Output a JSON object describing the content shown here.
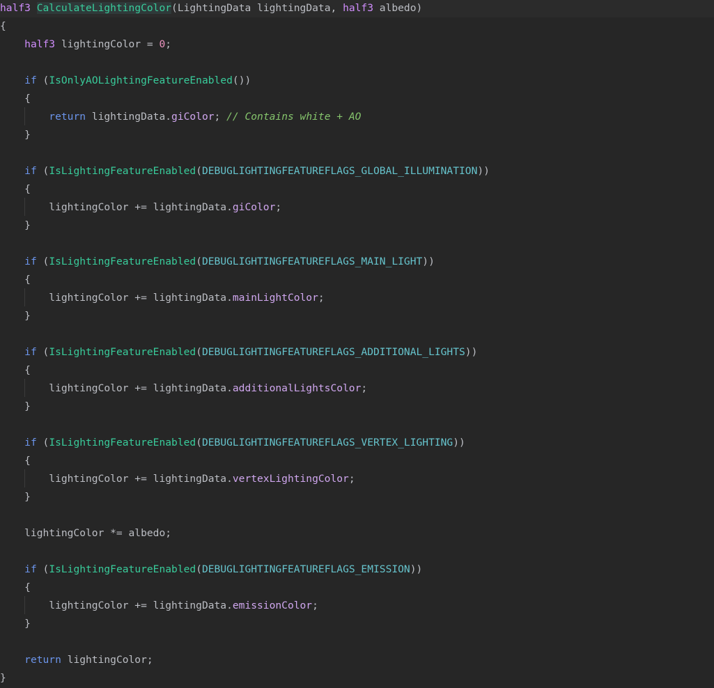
{
  "editor": {
    "language": "HLSL",
    "colors": {
      "background": "#262626",
      "keyword_type": "#cf8dfb",
      "keyword_control": "#6c95eb",
      "function": "#39cc9b",
      "constant": "#66c3cc",
      "field": "#d0a7ef",
      "comment": "#85c46c",
      "number": "#ed94c0",
      "text": "#bcbec4"
    },
    "lines": [
      [
        [
          "kw",
          "half3"
        ],
        [
          "plain",
          " "
        ],
        [
          "fn-decl",
          "CalculateLightingColor"
        ],
        [
          "plain",
          "("
        ],
        [
          "plain",
          "LightingData"
        ],
        [
          "plain",
          " lightingData, "
        ],
        [
          "kw",
          "half3"
        ],
        [
          "plain",
          " albedo)"
        ]
      ],
      [
        [
          "plain",
          "{"
        ]
      ],
      [
        [
          "plain",
          "    "
        ],
        [
          "kw",
          "half3"
        ],
        [
          "plain",
          " lightingColor = "
        ],
        [
          "num",
          "0"
        ],
        [
          "plain",
          ";"
        ]
      ],
      [],
      [
        [
          "plain",
          "    "
        ],
        [
          "kwb",
          "if"
        ],
        [
          "plain",
          " ("
        ],
        [
          "fn",
          "IsOnlyAOLightingFeatureEnabled"
        ],
        [
          "plain",
          "())"
        ]
      ],
      [
        [
          "plain",
          "    {"
        ]
      ],
      [
        [
          "plain",
          "        "
        ],
        [
          "kwb",
          "return"
        ],
        [
          "plain",
          " lightingData."
        ],
        [
          "field",
          "giColor"
        ],
        [
          "plain",
          "; "
        ],
        [
          "comment",
          "// Contains white + AO"
        ]
      ],
      [
        [
          "plain",
          "    }"
        ]
      ],
      [],
      [
        [
          "plain",
          "    "
        ],
        [
          "kwb",
          "if"
        ],
        [
          "plain",
          " ("
        ],
        [
          "fn",
          "IsLightingFeatureEnabled"
        ],
        [
          "plain",
          "("
        ],
        [
          "const",
          "DEBUGLIGHTINGFEATUREFLAGS_GLOBAL_ILLUMINATION"
        ],
        [
          "plain",
          "))"
        ]
      ],
      [
        [
          "plain",
          "    {"
        ]
      ],
      [
        [
          "plain",
          "        lightingColor += lightingData."
        ],
        [
          "field",
          "giColor"
        ],
        [
          "plain",
          ";"
        ]
      ],
      [
        [
          "plain",
          "    }"
        ]
      ],
      [],
      [
        [
          "plain",
          "    "
        ],
        [
          "kwb",
          "if"
        ],
        [
          "plain",
          " ("
        ],
        [
          "fn",
          "IsLightingFeatureEnabled"
        ],
        [
          "plain",
          "("
        ],
        [
          "const",
          "DEBUGLIGHTINGFEATUREFLAGS_MAIN_LIGHT"
        ],
        [
          "plain",
          "))"
        ]
      ],
      [
        [
          "plain",
          "    {"
        ]
      ],
      [
        [
          "plain",
          "        lightingColor += lightingData."
        ],
        [
          "field",
          "mainLightColor"
        ],
        [
          "plain",
          ";"
        ]
      ],
      [
        [
          "plain",
          "    }"
        ]
      ],
      [],
      [
        [
          "plain",
          "    "
        ],
        [
          "kwb",
          "if"
        ],
        [
          "plain",
          " ("
        ],
        [
          "fn",
          "IsLightingFeatureEnabled"
        ],
        [
          "plain",
          "("
        ],
        [
          "const",
          "DEBUGLIGHTINGFEATUREFLAGS_ADDITIONAL_LIGHTS"
        ],
        [
          "plain",
          "))"
        ]
      ],
      [
        [
          "plain",
          "    {"
        ]
      ],
      [
        [
          "plain",
          "        lightingColor += lightingData."
        ],
        [
          "field",
          "additionalLightsColor"
        ],
        [
          "plain",
          ";"
        ]
      ],
      [
        [
          "plain",
          "    }"
        ]
      ],
      [],
      [
        [
          "plain",
          "    "
        ],
        [
          "kwb",
          "if"
        ],
        [
          "plain",
          " ("
        ],
        [
          "fn",
          "IsLightingFeatureEnabled"
        ],
        [
          "plain",
          "("
        ],
        [
          "const",
          "DEBUGLIGHTINGFEATUREFLAGS_VERTEX_LIGHTING"
        ],
        [
          "plain",
          "))"
        ]
      ],
      [
        [
          "plain",
          "    {"
        ]
      ],
      [
        [
          "plain",
          "        lightingColor += lightingData."
        ],
        [
          "field",
          "vertexLightingColor"
        ],
        [
          "plain",
          ";"
        ]
      ],
      [
        [
          "plain",
          "    }"
        ]
      ],
      [],
      [
        [
          "plain",
          "    lightingColor *= albedo;"
        ]
      ],
      [],
      [
        [
          "plain",
          "    "
        ],
        [
          "kwb",
          "if"
        ],
        [
          "plain",
          " ("
        ],
        [
          "fn",
          "IsLightingFeatureEnabled"
        ],
        [
          "plain",
          "("
        ],
        [
          "const",
          "DEBUGLIGHTINGFEATUREFLAGS_EMISSION"
        ],
        [
          "plain",
          "))"
        ]
      ],
      [
        [
          "plain",
          "    {"
        ]
      ],
      [
        [
          "plain",
          "        lightingColor += lightingData."
        ],
        [
          "field",
          "emissionColor"
        ],
        [
          "plain",
          ";"
        ]
      ],
      [
        [
          "plain",
          "    }"
        ]
      ],
      [],
      [
        [
          "plain",
          "    "
        ],
        [
          "kwb",
          "return"
        ],
        [
          "plain",
          " lightingColor;"
        ]
      ],
      [
        [
          "plain",
          "}"
        ]
      ]
    ]
  }
}
